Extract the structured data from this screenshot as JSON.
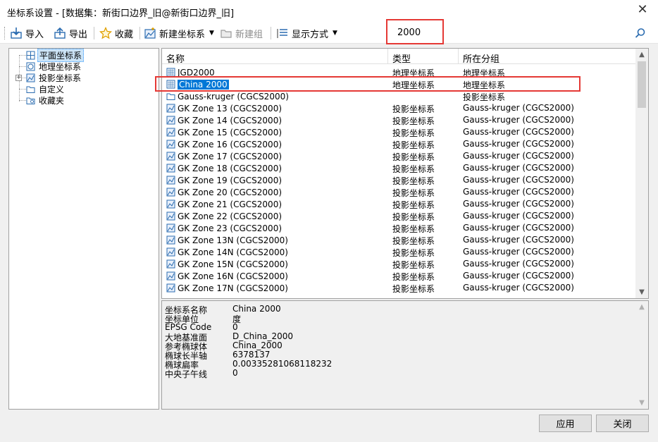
{
  "window": {
    "title": "坐标系设置 - [数据集：新街口边界_旧@新街口边界_旧]"
  },
  "toolbar": {
    "import_label": "导入",
    "export_label": "导出",
    "favorite_label": "收藏",
    "new_cs_label": "新建坐标系",
    "new_group_label": "新建组",
    "display_mode_label": "显示方式"
  },
  "search": {
    "value": "2000"
  },
  "tree": {
    "items": [
      {
        "label": "平面坐标系"
      },
      {
        "label": "地理坐标系"
      },
      {
        "label": "投影坐标系"
      },
      {
        "label": "自定义"
      },
      {
        "label": "收藏夹"
      }
    ]
  },
  "list": {
    "headers": {
      "name": "名称",
      "type": "类型",
      "group": "所在分组"
    },
    "rows": [
      {
        "name": "JGD2000",
        "type": "地理坐标系",
        "group": "地理坐标系",
        "icon": "geo"
      },
      {
        "name": "China 2000",
        "type": "地理坐标系",
        "group": "地理坐标系",
        "icon": "geo"
      },
      {
        "name": "Gauss-kruger (CGCS2000)",
        "type": "",
        "group": "投影坐标系",
        "icon": "folder"
      },
      {
        "name": "GK Zone 13      (CGCS2000)",
        "type": "投影坐标系",
        "group": "Gauss-kruger (CGCS2000)",
        "icon": "proj"
      },
      {
        "name": "GK Zone 14      (CGCS2000)",
        "type": "投影坐标系",
        "group": "Gauss-kruger (CGCS2000)",
        "icon": "proj"
      },
      {
        "name": "GK Zone 15      (CGCS2000)",
        "type": "投影坐标系",
        "group": "Gauss-kruger (CGCS2000)",
        "icon": "proj"
      },
      {
        "name": "GK Zone 16      (CGCS2000)",
        "type": "投影坐标系",
        "group": "Gauss-kruger (CGCS2000)",
        "icon": "proj"
      },
      {
        "name": "GK Zone 17      (CGCS2000)",
        "type": "投影坐标系",
        "group": "Gauss-kruger (CGCS2000)",
        "icon": "proj"
      },
      {
        "name": "GK Zone 18      (CGCS2000)",
        "type": "投影坐标系",
        "group": "Gauss-kruger (CGCS2000)",
        "icon": "proj"
      },
      {
        "name": "GK Zone 19      (CGCS2000)",
        "type": "投影坐标系",
        "group": "Gauss-kruger (CGCS2000)",
        "icon": "proj"
      },
      {
        "name": "GK Zone 20      (CGCS2000)",
        "type": "投影坐标系",
        "group": "Gauss-kruger (CGCS2000)",
        "icon": "proj"
      },
      {
        "name": "GK Zone 21      (CGCS2000)",
        "type": "投影坐标系",
        "group": "Gauss-kruger (CGCS2000)",
        "icon": "proj"
      },
      {
        "name": "GK Zone 22      (CGCS2000)",
        "type": "投影坐标系",
        "group": "Gauss-kruger (CGCS2000)",
        "icon": "proj"
      },
      {
        "name": "GK Zone 23      (CGCS2000)",
        "type": "投影坐标系",
        "group": "Gauss-kruger (CGCS2000)",
        "icon": "proj"
      },
      {
        "name": "GK Zone 13N     (CGCS2000)",
        "type": "投影坐标系",
        "group": "Gauss-kruger (CGCS2000)",
        "icon": "proj"
      },
      {
        "name": "GK Zone 14N     (CGCS2000)",
        "type": "投影坐标系",
        "group": "Gauss-kruger (CGCS2000)",
        "icon": "proj"
      },
      {
        "name": "GK Zone 15N     (CGCS2000)",
        "type": "投影坐标系",
        "group": "Gauss-kruger (CGCS2000)",
        "icon": "proj"
      },
      {
        "name": "GK Zone 16N     (CGCS2000)",
        "type": "投影坐标系",
        "group": "Gauss-kruger (CGCS2000)",
        "icon": "proj"
      },
      {
        "name": "GK Zone 17N     (CGCS2000)",
        "type": "投影坐标系",
        "group": "Gauss-kruger (CGCS2000)",
        "icon": "proj"
      }
    ]
  },
  "details": [
    {
      "key": "坐标系名称",
      "value": "China 2000"
    },
    {
      "key": "坐标单位",
      "value": "度"
    },
    {
      "key": "EPSG Code",
      "value": "0"
    },
    {
      "key": "大地基准面",
      "value": "D_China_2000"
    },
    {
      "key": "参考椭球体",
      "value": "China_2000"
    },
    {
      "key": "椭球长半轴",
      "value": "6378137"
    },
    {
      "key": "椭球扁率",
      "value": "0.00335281068118232"
    },
    {
      "key": "中央子午线",
      "value": "0"
    }
  ],
  "buttons": {
    "apply_label": "应用",
    "close_label": "关闭"
  },
  "colors": {
    "selection": "#0078d7",
    "annotation_red": "#e53935",
    "icon_blue": "#2b6cb0"
  }
}
